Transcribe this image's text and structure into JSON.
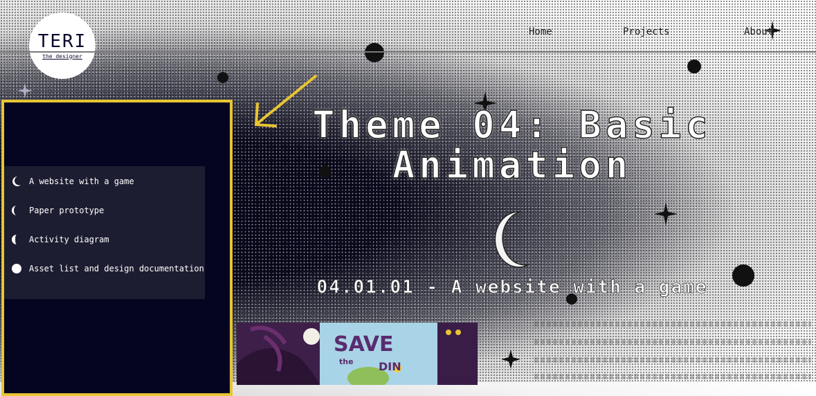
{
  "logo": {
    "title": "TERI",
    "subtitle": "the_designer"
  },
  "nav": {
    "home": "Home",
    "projects": "Projects",
    "about": "About"
  },
  "sidebar": {
    "items": [
      {
        "label": "A website with a game",
        "icon": "crescent-moon-icon"
      },
      {
        "label": "Paper prototype",
        "icon": "waxing-moon-icon"
      },
      {
        "label": "Activity diagram",
        "icon": "gibbous-moon-icon"
      },
      {
        "label": "Asset list and design documentation",
        "icon": "full-moon-icon"
      }
    ]
  },
  "hero": {
    "title_line1": "Theme 04: Basic",
    "title_line2": "Animation"
  },
  "section": {
    "heading": "04.01.01 - A website with a game"
  },
  "thumbnail": {
    "save": "SAVE",
    "the": "the",
    "din": "DIN"
  },
  "colors": {
    "accent_yellow": "#e8c532",
    "dark_navy": "#050522",
    "text_white": "#ffffff"
  }
}
